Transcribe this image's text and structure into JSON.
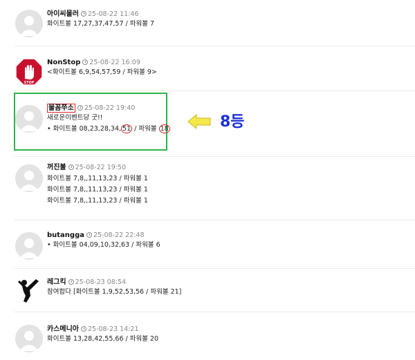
{
  "comments": [
    {
      "nick": "아이씨몰러",
      "time": "25-08-22 11:46",
      "lines": [
        "화이트볼 17,27,37,47,57 / 파워볼 7"
      ]
    },
    {
      "nick": "NonStop",
      "time": "25-08-22 16:09",
      "lines": [
        "<화이트볼 6,9,54,57,59 / 파워볼 9>"
      ]
    },
    {
      "nick": "물꼼쭈소",
      "time": "25-08-22 19:40",
      "lines": [
        "새로운이벤트당 굿!!"
      ],
      "highlight": {
        "prefix": "• 화이트볼 08,23,28,34,",
        "circled_white": "51",
        "middle": " / 파워볼 ",
        "circled_power": "18"
      }
    },
    {
      "nick": "꺼진불",
      "time": "25-08-22 19:50",
      "lines": [
        "화이트볼 7,8,,11,13,23 / 파워볼 1",
        "화이트볼 7,8,,11,13,23 / 파워볼 1",
        "화이트볼 7,8,,11,13,23 / 파워볼 1"
      ]
    },
    {
      "nick": "butangga",
      "time": "25-08-22 22:48",
      "lines": [
        "• 화이트볼 04,09,10,32,63 / 파워볼 6"
      ]
    },
    {
      "nick": "레그킥",
      "time": "25-08-23 08:54",
      "lines": [
        "참여합다 [화이트볼 1,9,52,53,56 / 파워볼 21]"
      ]
    },
    {
      "nick": "카스메니아",
      "time": "25-08-23 14:21",
      "lines": [
        "화이트볼 13,28,42,55,66 / 파워볼 20"
      ]
    }
  ],
  "annotation": {
    "rank_label": "8등"
  },
  "colors": {
    "green_box": "#2db34a",
    "red_mark": "#e02020",
    "rank_text": "#1a2fd8",
    "arrow_fill": "#f5e84a"
  },
  "icons": {
    "default_avatar": "person-silhouette-icon",
    "stop_sign": "stop-sign-icon",
    "kick_silhouette": "kick-silhouette-icon"
  }
}
